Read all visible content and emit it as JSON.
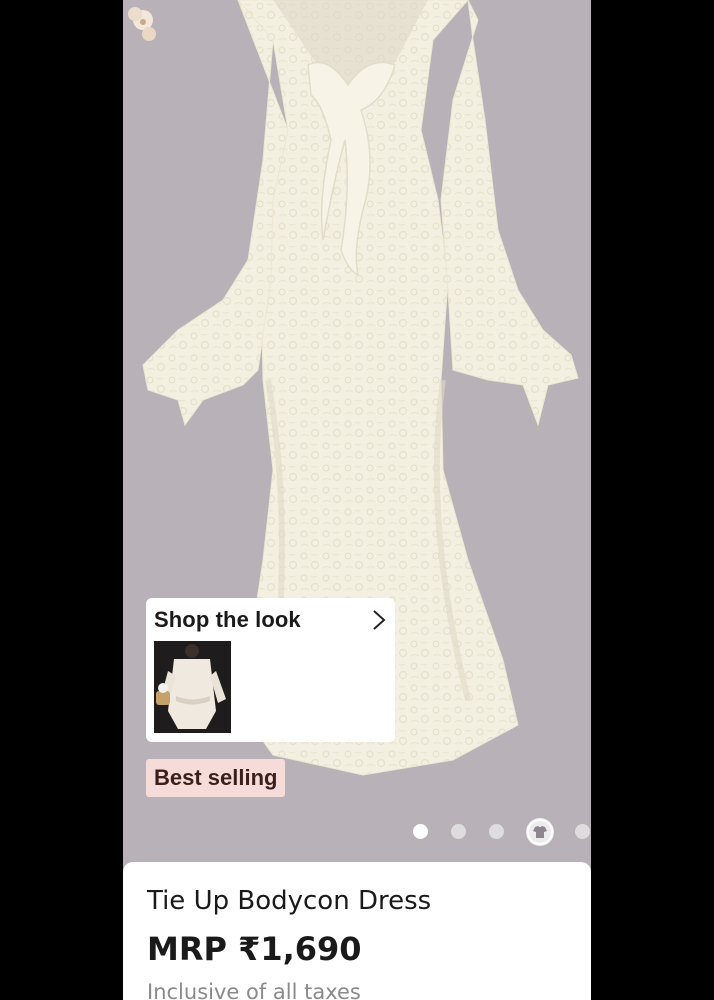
{
  "product": {
    "name": "Tie Up Bodycon Dress",
    "price": "MRP ₹1,690",
    "tax_note": "Inclusive of all taxes",
    "image_description_icon": "dress-image"
  },
  "shop_the_look": {
    "title": "Shop the look",
    "chevron_icon": "chevron-right-icon"
  },
  "badge": {
    "label": "Best selling"
  },
  "carousel": {
    "total_slides": 5,
    "active_index": 0,
    "last_icon": "garment-icon"
  },
  "colors": {
    "image_background": "#b8b2b8",
    "badge_background": "#f6dcd8",
    "badge_text": "#3b1f1c",
    "dress": "#f3efe0"
  }
}
